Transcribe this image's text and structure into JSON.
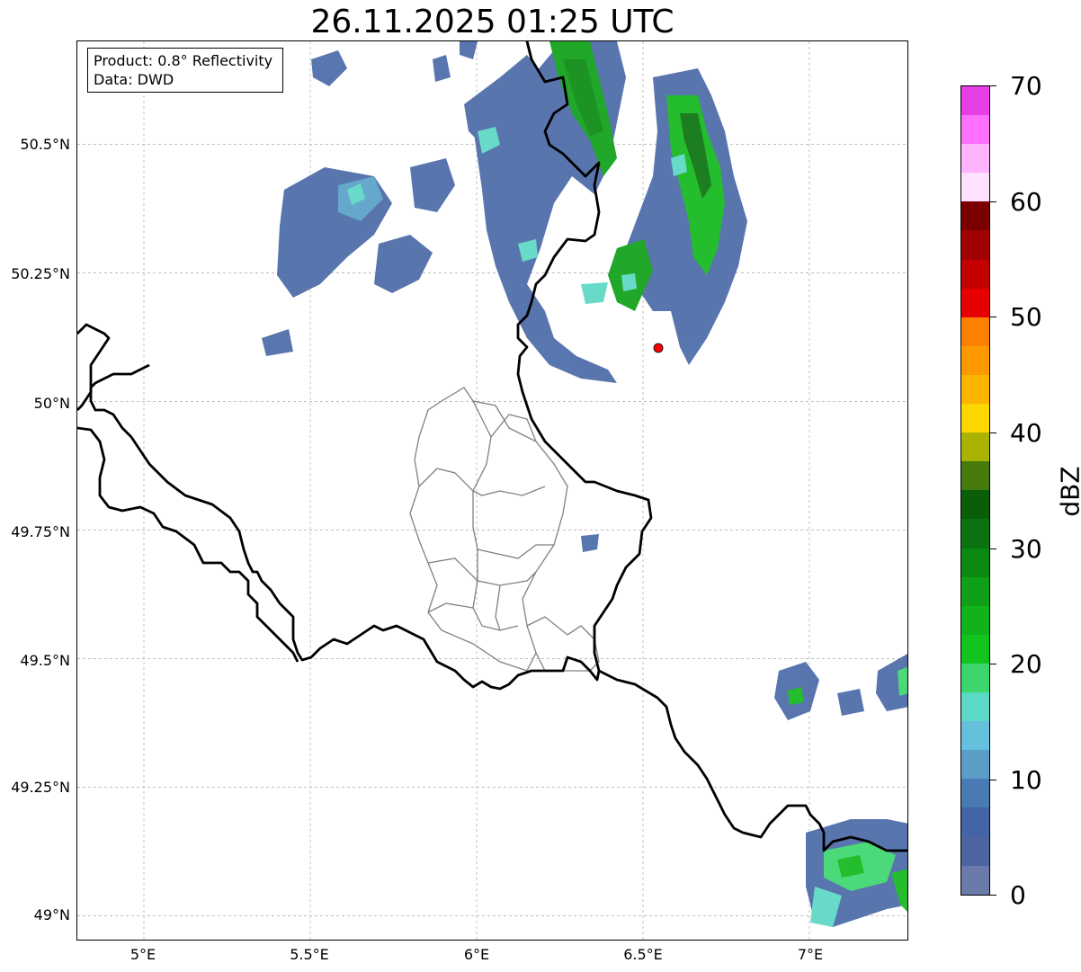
{
  "title": "26.11.2025 01:25 UTC",
  "info": {
    "product": "Product: 0.8° Reflectivity",
    "source": "Data: DWD"
  },
  "axes": {
    "lat_labels": [
      "50.5°N",
      "50.25°N",
      "50°N",
      "49.75°N",
      "49.5°N",
      "49.25°N",
      "49°N"
    ],
    "lon_labels": [
      "5°E",
      "5.5°E",
      "6°E",
      "6.5°E",
      "7°E"
    ],
    "lat_values": [
      50.5,
      50.25,
      50.0,
      49.75,
      49.5,
      49.25,
      49.0
    ],
    "lon_values": [
      5.0,
      5.5,
      6.0,
      6.5,
      7.0
    ],
    "lon_range": [
      4.8,
      7.3
    ],
    "lat_range": [
      48.95,
      50.7
    ],
    "grid": true
  },
  "radar_marker": {
    "lon": 6.55,
    "lat": 50.11,
    "color": "#ff0000"
  },
  "colorbar": {
    "unit": "dBZ",
    "tick_labels": [
      "70",
      "60",
      "50",
      "40",
      "30",
      "20",
      "10",
      "0"
    ],
    "min": 0,
    "max": 70,
    "colors_top_to_bottom": [
      "#e83ee8",
      "#ff70ff",
      "#ffb3ff",
      "#ffe0ff",
      "#7a0000",
      "#a00000",
      "#c40000",
      "#e60000",
      "#ff7f00",
      "#ff9900",
      "#ffb400",
      "#ffd700",
      "#aab300",
      "#467a0a",
      "#0a5e0a",
      "#0a730f",
      "#0a8a12",
      "#0fa017",
      "#10b31b",
      "#12c41e",
      "#3dd66e",
      "#5cd8c4",
      "#64c0dc",
      "#5a9ec8",
      "#4a7ab4",
      "#4463a8",
      "#4d64a0",
      "#6a7aaa"
    ]
  },
  "colors": {
    "border": "#000000",
    "admin": "#808080",
    "echo_weak": "#4a6aa8",
    "echo_mid": "#5cd8c4",
    "echo_strong": "#12b81c"
  }
}
